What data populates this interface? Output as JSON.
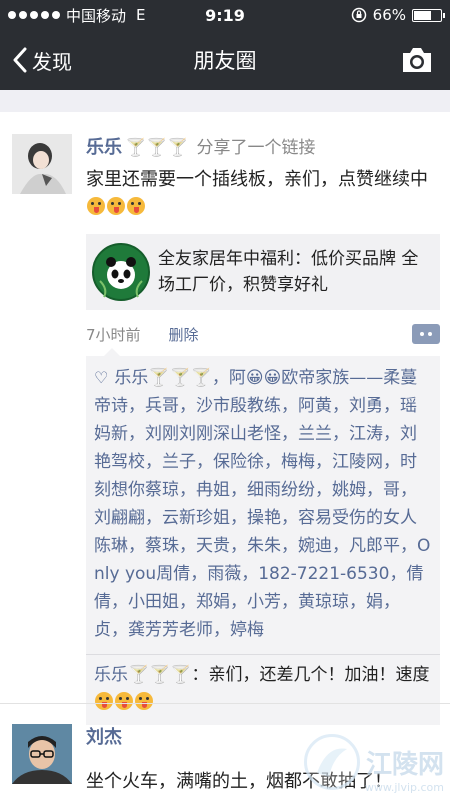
{
  "status_bar": {
    "carrier": "中国移动",
    "network": "E",
    "time": "9:19",
    "battery_text": "66%",
    "battery_level": 0.66
  },
  "nav": {
    "back_label": "发现",
    "title": "朋友圈"
  },
  "post1": {
    "author": "乐乐",
    "author_decor": "🍸🍸🍸",
    "action": "分享了一个链接",
    "text": "家里还需要一个插线板，亲们，点赞继续中",
    "link": {
      "title": "全友家居年中福利：低价买品牌 全场工厂价，积赞享好礼"
    },
    "time_ago": "7小时前",
    "delete_label": "删除",
    "likes_text": "乐乐🍸🍸🍸，阿😀😀欧帝家族——柔蔓帝诗，兵哥，沙市殷教练，阿黄，刘勇，瑶妈新，刘刚刘刚深山老怪，兰兰，江涛，刘艳驾校，兰子，保险徐，梅梅，江陵网，时刻想你蔡琼，冉姐，细雨纷纷，姚姆，哥，刘翩翩，云新珍姐，操艳，容易受伤的女人陈琳，蔡珠，天贵，朱朱，婉迪，凡郎平，Only you周倩，雨薇，182-7221-6530，倩倩，小田姐，郑娟，小芳，黄琼琼，娟，贞，龚芳芳老师，婷梅",
    "comment": {
      "name": "乐乐🍸🍸🍸",
      "text": "：亲们，还差几个！加油！速度"
    }
  },
  "post2": {
    "author": "刘杰",
    "text": "坐个火车，满嘴的土，烟都不敢抽了！"
  },
  "watermark": {
    "text": "江陵网",
    "url": "www.jlvip.com"
  },
  "colors": {
    "bar_bg": "#2b2e33",
    "name_blue": "#576b95",
    "panel_bg": "#f3f3f5"
  }
}
